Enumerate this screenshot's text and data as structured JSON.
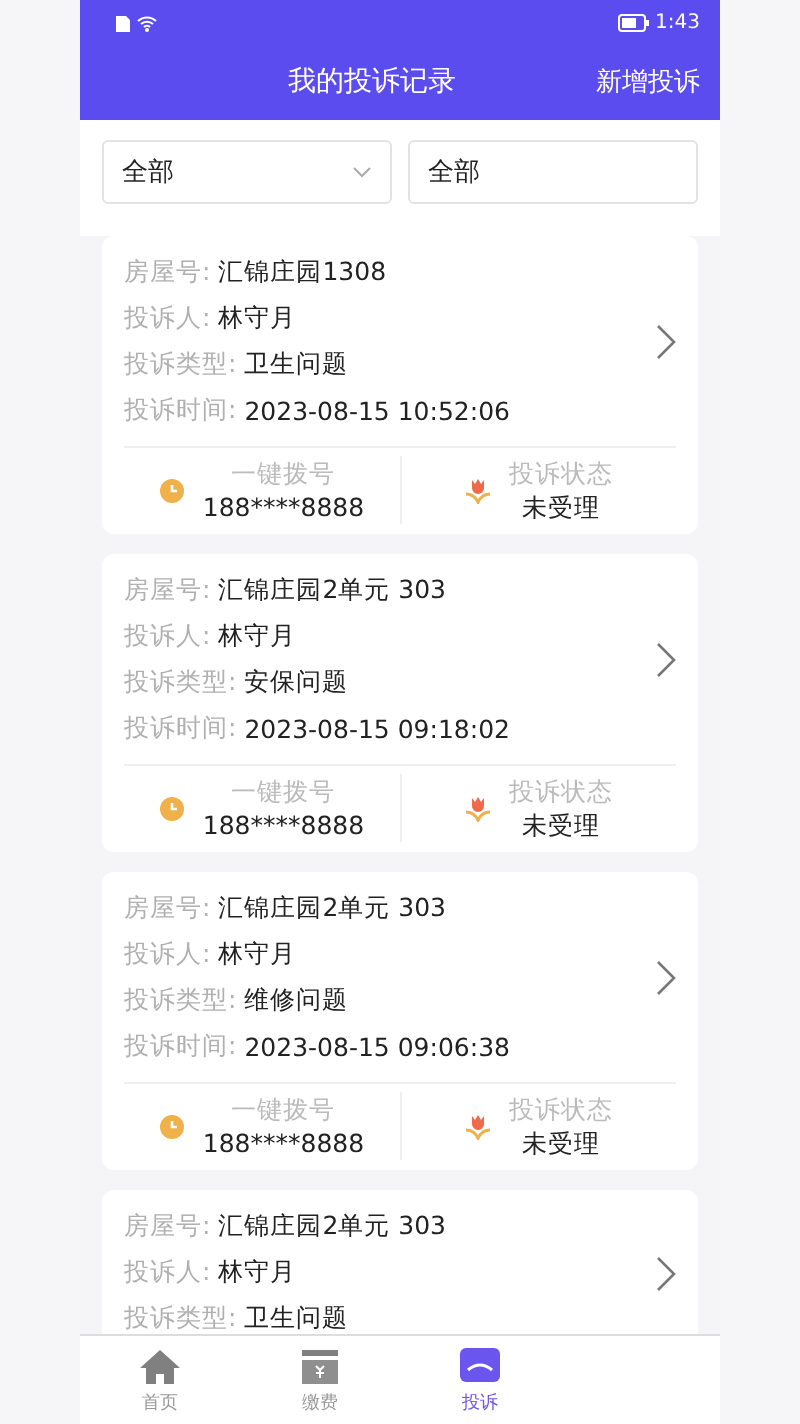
{
  "status_bar": {
    "time": "1:43"
  },
  "header": {
    "title": "我的投诉记录",
    "action": "新增投诉"
  },
  "filters": [
    {
      "kind": "dropdown",
      "value": "全部"
    },
    {
      "kind": "text",
      "value": "全部"
    }
  ],
  "complaints": [
    {
      "fields": [
        {
          "label": "房屋号:",
          "value": "汇锦庄园1308"
        },
        {
          "label": "投诉人:",
          "value": "林守月"
        },
        {
          "label": "投诉类型:",
          "value": "卫生问题"
        },
        {
          "label": "投诉时间:",
          "value": "2023-08-15 10:52:06"
        }
      ],
      "footer": {
        "dial_label": "一键拨号",
        "phone": "188****8888",
        "status_label": "投诉状态",
        "status": "未受理"
      }
    },
    {
      "fields": [
        {
          "label": "房屋号:",
          "value": "汇锦庄园2单元 303"
        },
        {
          "label": "投诉人:",
          "value": "林守月"
        },
        {
          "label": "投诉类型:",
          "value": "安保问题"
        },
        {
          "label": "投诉时间:",
          "value": "2023-08-15 09:18:02"
        }
      ],
      "footer": {
        "dial_label": "一键拨号",
        "phone": "188****8888",
        "status_label": "投诉状态",
        "status": "未受理"
      }
    },
    {
      "fields": [
        {
          "label": "房屋号:",
          "value": "汇锦庄园2单元 303"
        },
        {
          "label": "投诉人:",
          "value": "林守月"
        },
        {
          "label": "投诉类型:",
          "value": "维修问题"
        },
        {
          "label": "投诉时间:",
          "value": "2023-08-15 09:06:38"
        }
      ],
      "footer": {
        "dial_label": "一键拨号",
        "phone": "188****8888",
        "status_label": "投诉状态",
        "status": "未受理"
      }
    },
    {
      "fields": [
        {
          "label": "房屋号:",
          "value": "汇锦庄园2单元 303"
        },
        {
          "label": "投诉人:",
          "value": "林守月"
        },
        {
          "label": "投诉类型:",
          "value": "卫生问题"
        }
      ]
    }
  ],
  "tab_bar": [
    {
      "kind": "home",
      "label": "首页",
      "selected": false
    },
    {
      "kind": "bill",
      "label": "缴费",
      "selected": false
    },
    {
      "kind": "complaint",
      "label": "投诉",
      "selected": true
    }
  ]
}
